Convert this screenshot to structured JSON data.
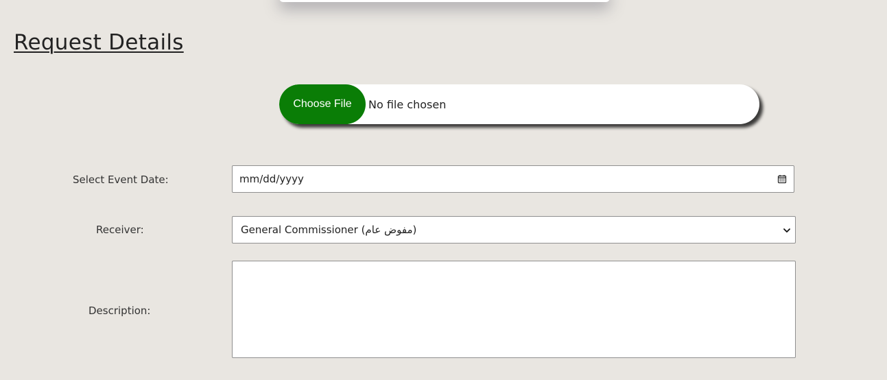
{
  "section": {
    "title": "Request Details"
  },
  "file_picker": {
    "button_label": "Choose File",
    "status_text": "No file chosen",
    "button_color": "#0a7d06"
  },
  "form": {
    "event_date": {
      "label": "Select Event Date:",
      "placeholder": "mm/dd/yyyy",
      "icon": "calendar-icon"
    },
    "receiver": {
      "label": "Receiver:",
      "selected_value": "General Commissioner (مفوض عام)",
      "icon": "chevron-down-icon"
    },
    "description": {
      "label": "Description:",
      "value": ""
    }
  }
}
